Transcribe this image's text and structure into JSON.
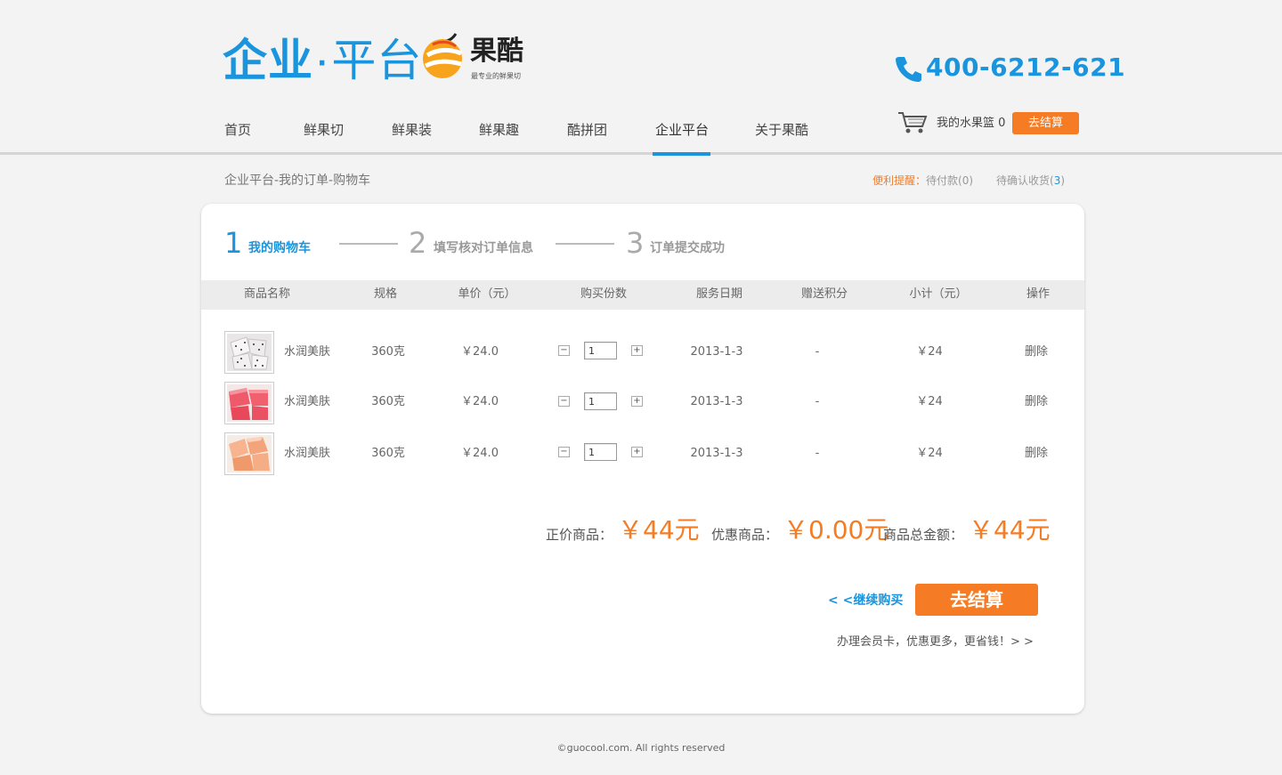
{
  "header": {
    "logo_main": "企业",
    "logo_dot": "·",
    "logo_sub": "平台",
    "brand_name": "果酷",
    "brand_tagline": "最专业的鲜果切",
    "phone": "400-6212-621"
  },
  "nav": {
    "items": [
      "首页",
      "鲜果切",
      "鲜果装",
      "鲜果趣",
      "酷拼团",
      "企业平台",
      "关于果酷"
    ],
    "active_index": 5,
    "basket_label": "我的水果篮 0",
    "checkout_label": "去结算"
  },
  "breadcrumb": "企业平台-我的订单-购物车",
  "reminder": {
    "label": "便利提醒",
    "colon": "：",
    "pending_payment": "待付款(0)",
    "pending_receipt_prefix": "待确认收货(",
    "pending_receipt_count": "3",
    "pending_receipt_suffix": ")"
  },
  "steps": [
    {
      "num": "1",
      "label": "我的购物车"
    },
    {
      "num": "2",
      "label": "填写核对订单信息"
    },
    {
      "num": "3",
      "label": "订单提交成功"
    }
  ],
  "table": {
    "headers": [
      "商品名称",
      "规格",
      "单价（元）",
      "购买份数",
      "服务日期",
      "赠送积分",
      "小计（元）",
      "操作"
    ],
    "rows": [
      {
        "name": "水润美肤",
        "spec": "360克",
        "price": "￥24.0",
        "qty": "1",
        "date": "2013-1-3",
        "points": "-",
        "subtotal": "￥24",
        "action": "删除",
        "minus": "−",
        "plus": "+"
      },
      {
        "name": "水润美肤",
        "spec": "360克",
        "price": "￥24.0",
        "qty": "1",
        "date": "2013-1-3",
        "points": "-",
        "subtotal": "￥24",
        "action": "删除",
        "minus": "−",
        "plus": "+"
      },
      {
        "name": "水润美肤",
        "spec": "360克",
        "price": "￥24.0",
        "qty": "1",
        "date": "2013-1-3",
        "points": "-",
        "subtotal": "￥24",
        "action": "删除",
        "minus": "−",
        "plus": "+"
      }
    ]
  },
  "totals": {
    "regular_label": "正价商品：",
    "regular_value": "￥44元",
    "discount_label": "优惠商品：",
    "discount_value": "￥0.00元",
    "total_label": "商品总金额：",
    "total_value": "￥44元"
  },
  "actions": {
    "continue": "< <继续购买",
    "checkout": "去结算",
    "member": "办理会员卡，优惠更多，更省钱！> >"
  },
  "footer": "©guocool.com. All rights reserved",
  "colors": {
    "accent": "#1a95dd",
    "orange": "#f57c25"
  },
  "icons": [
    "phone-icon",
    "cart-icon",
    "brand-logo-icon"
  ]
}
